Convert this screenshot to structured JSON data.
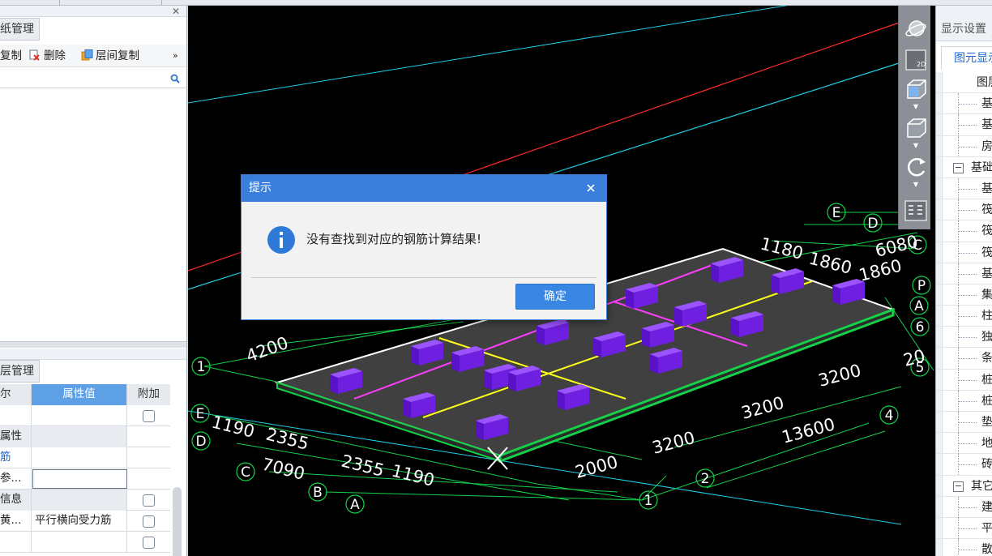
{
  "left_panel": {
    "top_section": {
      "tab_label": "纸管理",
      "toolbar": {
        "copy_label": "复制",
        "delete_label": "删除",
        "floor_copy_label": "层间复制",
        "more_label": "»"
      },
      "search": {
        "value": "",
        "placeholder": ""
      }
    },
    "bottom_section": {
      "tab_label": "层管理",
      "grid": {
        "headers": [
          "尔",
          "属性值",
          "附加"
        ],
        "rows": [
          {
            "name": "",
            "value": "",
            "has_checkbox": true
          },
          {
            "name": "属性",
            "value": "",
            "has_checkbox": false,
            "group": true
          },
          {
            "name": "筋",
            "value": "",
            "has_checkbox": false,
            "blue": true
          },
          {
            "name": "参...",
            "value": "",
            "has_checkbox": false,
            "editing": true
          },
          {
            "name": "信息",
            "value": "",
            "has_checkbox": true,
            "group": true
          },
          {
            "name": "黄...",
            "value": "平行横向受力筋",
            "has_checkbox": true
          },
          {
            "name": "",
            "value": "",
            "has_checkbox": true
          }
        ]
      }
    }
  },
  "viewport": {
    "axis_labels": [
      "E",
      "D",
      "C",
      "P",
      "A",
      "6",
      "5",
      "4",
      "2",
      "1",
      "1",
      "E",
      "D",
      "C",
      "B",
      "A"
    ],
    "dimensions": [
      "1180",
      "1860",
      "6080",
      "1860",
      "4200",
      "1190",
      "2355",
      "7090",
      "2355",
      "1190",
      "2000",
      "3200",
      "3200",
      "3200",
      "13600",
      "20"
    ],
    "view_toolbar": {
      "btn_2d_label": "2D"
    }
  },
  "right_panel": {
    "tab_label": "显示设置",
    "subtab_label": "图元显示",
    "tree": [
      {
        "label": "图层",
        "level": "top"
      },
      {
        "label": "基",
        "level": "child"
      },
      {
        "label": "基",
        "level": "child"
      },
      {
        "label": "房",
        "level": "child"
      },
      {
        "label": "基础",
        "level": "group"
      },
      {
        "label": "基",
        "level": "child"
      },
      {
        "label": "筏",
        "level": "child"
      },
      {
        "label": "筏",
        "level": "child"
      },
      {
        "label": "筏",
        "level": "child"
      },
      {
        "label": "基",
        "level": "child"
      },
      {
        "label": "集",
        "level": "child"
      },
      {
        "label": "柱",
        "level": "child"
      },
      {
        "label": "独",
        "level": "child"
      },
      {
        "label": "条",
        "level": "child"
      },
      {
        "label": "桩",
        "level": "child"
      },
      {
        "label": "桩",
        "level": "child"
      },
      {
        "label": "垫",
        "level": "child"
      },
      {
        "label": "地",
        "level": "child"
      },
      {
        "label": "砖",
        "level": "child"
      },
      {
        "label": "其它",
        "level": "group"
      },
      {
        "label": "建",
        "level": "child"
      },
      {
        "label": "平",
        "level": "child"
      },
      {
        "label": "散",
        "level": "child"
      }
    ]
  },
  "dialog": {
    "title": "提示",
    "message": "没有查找到对应的钢筋计算结果!",
    "ok_label": "确定",
    "colors": {
      "title_bar": "#3a7fdb",
      "info_icon": "#2f7ad8",
      "button": "#3a86e3"
    }
  },
  "colors": {
    "slab": "#404040",
    "columns": "#6e1fe0",
    "axis_lines": "#15d14a",
    "magenta": "#ff3dff",
    "yellow": "#ffff1a"
  }
}
